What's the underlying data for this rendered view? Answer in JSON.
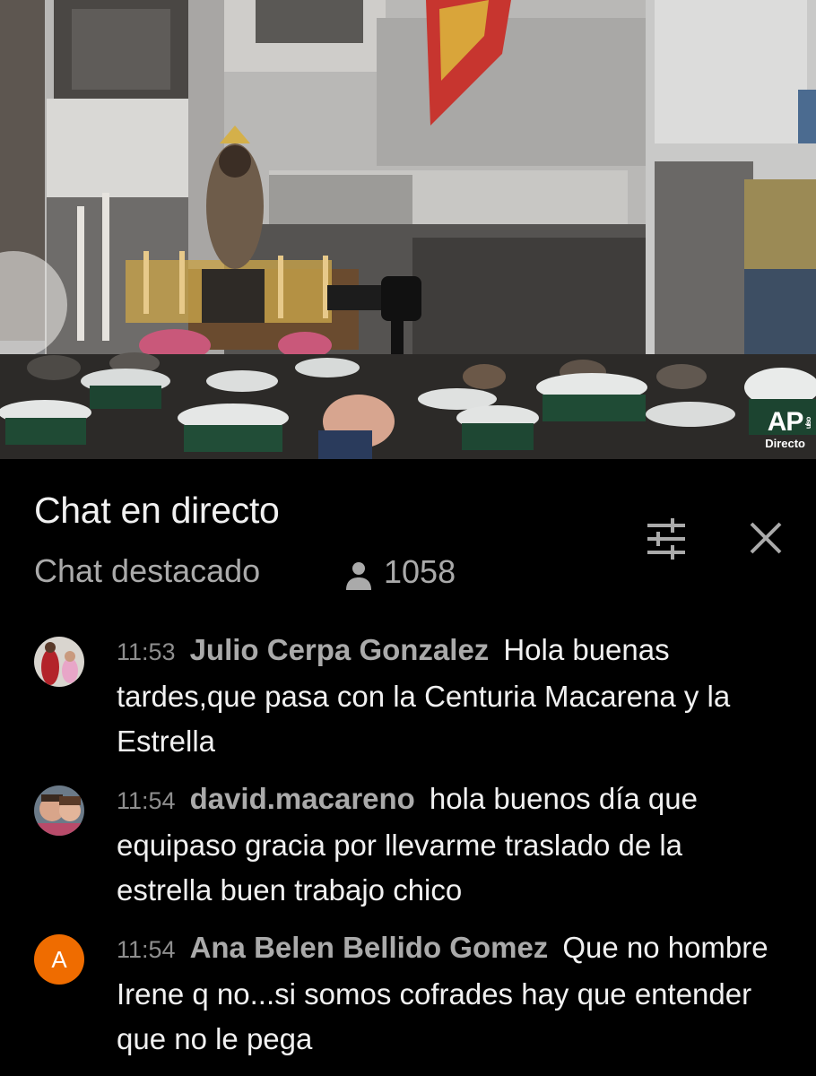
{
  "video": {
    "watermark_main": "AP",
    "watermark_small": "ulso",
    "watermark_sub": "Directo",
    "colors": {
      "watermark": "#ffffff"
    }
  },
  "chat": {
    "title": "Chat en directo",
    "mode": "Chat destacado",
    "viewer_count": "1058",
    "icons": {
      "viewers": "person-icon",
      "filter": "tune-icon",
      "close": "close-icon"
    },
    "colors": {
      "background": "#000000",
      "primary_text": "#f1f1f1",
      "secondary_text": "#aaaaaa",
      "timestamp": "#8e8e8e",
      "avatar_letter_bg": "#ef6c00"
    }
  },
  "messages": [
    {
      "time": "11:53",
      "author": "Julio Cerpa Gonzalez",
      "text": "Hola buenas tardes,que pasa con la Centuria Macarena y la Estrella",
      "avatar": "photo"
    },
    {
      "time": "11:54",
      "author": "david.macareno",
      "text": "hola buenos día que equipaso gracia por llevarme traslado de la estrella buen trabajo chico",
      "avatar": "photo"
    },
    {
      "time": "11:54",
      "author": "Ana Belen Bellido Gomez",
      "text": "Que no hombre Irene q no...si somos cofrades hay que entender que no le pega",
      "avatar_letter": "A"
    }
  ]
}
